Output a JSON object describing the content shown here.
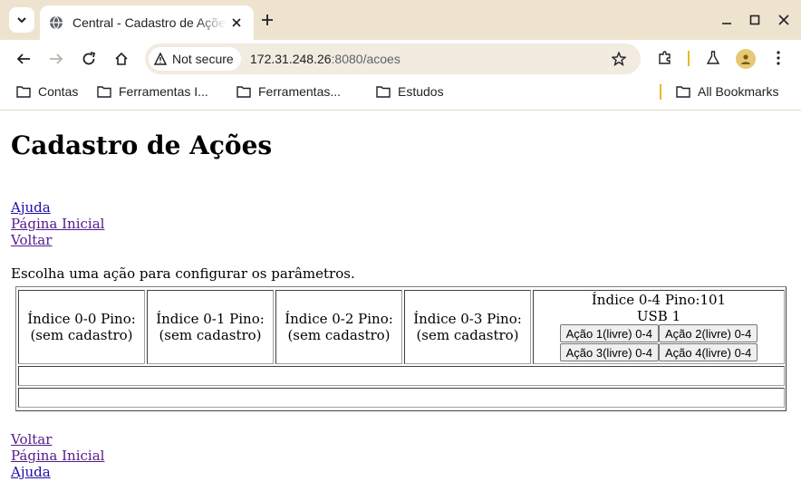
{
  "browser": {
    "tab_title": "Central - Cadastro de Ações",
    "security_label": "Not secure",
    "url_host": "172.31.248.26",
    "url_rest": ":8080/acoes",
    "bookmarks": [
      {
        "label": "Contas"
      },
      {
        "label": "Ferramentas I..."
      },
      {
        "label": "Ferramentas..."
      },
      {
        "label": "Estudos"
      }
    ],
    "all_bookmarks_label": "All Bookmarks"
  },
  "page": {
    "title": "Cadastro de Ações",
    "top_links": [
      "Ajuda",
      "Página Inicial",
      "Voltar"
    ],
    "intro": "Escolha uma ação para configurar os parâmetros.",
    "cells": [
      {
        "line1": "Índice 0-0 Pino:",
        "line2": "(sem cadastro)"
      },
      {
        "line1": "Índice 0-1 Pino:",
        "line2": "(sem cadastro)"
      },
      {
        "line1": "Índice 0-2 Pino:",
        "line2": "(sem cadastro)"
      },
      {
        "line1": "Índice 0-3 Pino:",
        "line2": "(sem cadastro)"
      },
      {
        "line1": "Índice 0-4 Pino:101",
        "line2": "USB 1",
        "buttons": [
          "Ação 1(livre) 0-4",
          "Ação 2(livre) 0-4",
          "Ação 3(livre) 0-4",
          "Ação 4(livre) 0-4"
        ]
      }
    ],
    "bottom_links": [
      "Voltar",
      "Página Inicial",
      "Ajuda"
    ]
  },
  "colors": {
    "tabbar_bg": "#ede3cf",
    "link": "#1a0dab",
    "visited_link": "#551a8b",
    "separator": "#e8b923"
  }
}
